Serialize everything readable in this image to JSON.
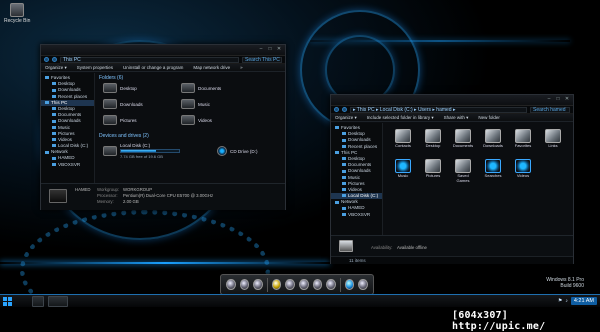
{
  "desktop": {
    "recycle_bin": "Recycle Bin",
    "watermark_os": "Windows 8.1 Pro",
    "watermark_build": "Build 9600"
  },
  "window1": {
    "title": "This PC",
    "address": "This PC",
    "search": "Search This PC",
    "toolbar": [
      "Organize ▾",
      "System properties",
      "Uninstall or change a program",
      "Map network drive",
      "»"
    ],
    "sidebar": [
      {
        "label": "Favorites",
        "kind": "hd"
      },
      {
        "label": "Desktop",
        "kind": "sub"
      },
      {
        "label": "Downloads",
        "kind": "sub"
      },
      {
        "label": "Recent places",
        "kind": "sub"
      },
      {
        "label": "This PC",
        "kind": "hd",
        "sel": true
      },
      {
        "label": "Desktop",
        "kind": "sub"
      },
      {
        "label": "Documents",
        "kind": "sub"
      },
      {
        "label": "Downloads",
        "kind": "sub"
      },
      {
        "label": "Music",
        "kind": "sub"
      },
      {
        "label": "Pictures",
        "kind": "sub"
      },
      {
        "label": "Videos",
        "kind": "sub"
      },
      {
        "label": "Local Disk (C:)",
        "kind": "sub"
      },
      {
        "label": "Network",
        "kind": "hd"
      },
      {
        "label": "HAMED",
        "kind": "sub"
      },
      {
        "label": "VBOXSVR",
        "kind": "sub"
      }
    ],
    "folders_header": "Folders (6)",
    "folders": [
      "Desktop",
      "Documents",
      "Downloads",
      "Music",
      "Pictures",
      "Videos"
    ],
    "devices_header": "Devices and drives (2)",
    "drive_label": "Local Disk (C:)",
    "drive_space": "7.74 GB free of 19.6 GB",
    "drive_used_fraction": 0.6,
    "dvd_label": "CD Drive (D:)",
    "details": {
      "computer": "HAMED",
      "workgroup_label": "Workgroup:",
      "workgroup": "WORKGROUP",
      "processor_label": "Processor:",
      "processor": "Pentium(R) Dual-Core CPU  E5700 @ 3.00GHz",
      "memory_label": "Memory:",
      "memory": "2.00 GB"
    }
  },
  "window2": {
    "address": "▸ This PC ▸ Local Disk (C:) ▸ Users ▸ hamed ▸",
    "search": "Search hamed",
    "toolbar": [
      "Organize ▾",
      "Include selected folder in library ▾",
      "Share with ▾",
      "New folder"
    ],
    "sidebar": [
      {
        "label": "Favorites",
        "kind": "hd"
      },
      {
        "label": "Desktop",
        "kind": "sub"
      },
      {
        "label": "Downloads",
        "kind": "sub"
      },
      {
        "label": "Recent places",
        "kind": "sub"
      },
      {
        "label": "This PC",
        "kind": "hd"
      },
      {
        "label": "Desktop",
        "kind": "sub"
      },
      {
        "label": "Documents",
        "kind": "sub"
      },
      {
        "label": "Downloads",
        "kind": "sub"
      },
      {
        "label": "Music",
        "kind": "sub"
      },
      {
        "label": "Pictures",
        "kind": "sub"
      },
      {
        "label": "Videos",
        "kind": "sub"
      },
      {
        "label": "Local Disk (C:)",
        "kind": "sub",
        "sel": true
      },
      {
        "label": "Network",
        "kind": "hd"
      },
      {
        "label": "HAMED",
        "kind": "sub"
      },
      {
        "label": "VBOXSVR",
        "kind": "sub"
      }
    ],
    "items": [
      "Contacts",
      "Desktop",
      "Documents",
      "Downloads",
      "Favorites",
      "Links",
      "Music",
      "Pictures",
      "Saved Games",
      "Searches",
      "Videos"
    ],
    "status": "11 items",
    "availability_label": "Availability:",
    "availability": "Available offline"
  },
  "taskbar": {
    "clock": "4:21 AM"
  },
  "footer": {
    "caption": "[604x307] http://upic.me/"
  }
}
